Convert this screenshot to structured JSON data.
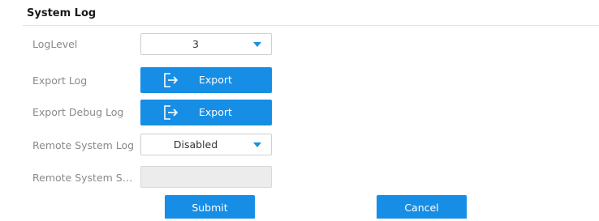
{
  "section": {
    "title": "System Log"
  },
  "form": {
    "log_level": {
      "label": "LogLevel",
      "value": "3"
    },
    "export_log": {
      "label": "Export Log",
      "button": "Export",
      "icon": "export-icon"
    },
    "export_debug_log": {
      "label": "Export Debug Log",
      "button": "Export",
      "icon": "export-icon"
    },
    "remote_system_log": {
      "label": "Remote System Log",
      "value": "Disabled"
    },
    "remote_system_server": {
      "label": "Remote System Ser...",
      "value": ""
    }
  },
  "actions": {
    "submit": "Submit",
    "cancel": "Cancel"
  },
  "colors": {
    "accent": "#168ee5",
    "caret": "#1a8fe0",
    "disabled_bg": "#ececec"
  }
}
